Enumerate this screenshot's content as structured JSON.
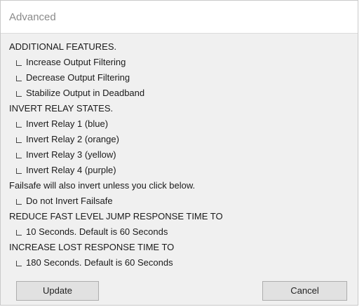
{
  "window": {
    "title": "Advanced"
  },
  "sections": {
    "additional_features": {
      "header": "ADDITIONAL FEATURES.",
      "options": [
        {
          "label": "Increase Output Filtering",
          "checked": false
        },
        {
          "label": "Decrease Output Filtering",
          "checked": false
        },
        {
          "label": "Stabilize Output in Deadband",
          "checked": false
        }
      ]
    },
    "invert_relay": {
      "header": "INVERT RELAY STATES.",
      "options": [
        {
          "label": "Invert Relay 1 (blue)",
          "checked": false
        },
        {
          "label": "Invert Relay 2 (orange)",
          "checked": false
        },
        {
          "label": "Invert Relay 3 (yellow)",
          "checked": false
        },
        {
          "label": "Invert Relay 4 (purple)",
          "checked": false
        }
      ]
    },
    "failsafe": {
      "note": "Failsafe will also invert unless you click below.",
      "options": [
        {
          "label": "Do not Invert Failsafe",
          "checked": false
        }
      ]
    },
    "fast_level_jump": {
      "header": "REDUCE FAST LEVEL JUMP RESPONSE TIME TO",
      "options": [
        {
          "label": "10 Seconds. Default is 60 Seconds",
          "checked": false
        }
      ]
    },
    "lost_response": {
      "header": "INCREASE LOST RESPONSE TIME TO",
      "options": [
        {
          "label": "180 Seconds. Default is 60 Seconds",
          "checked": false
        }
      ]
    }
  },
  "buttons": {
    "update": "Update",
    "cancel": "Cancel"
  }
}
